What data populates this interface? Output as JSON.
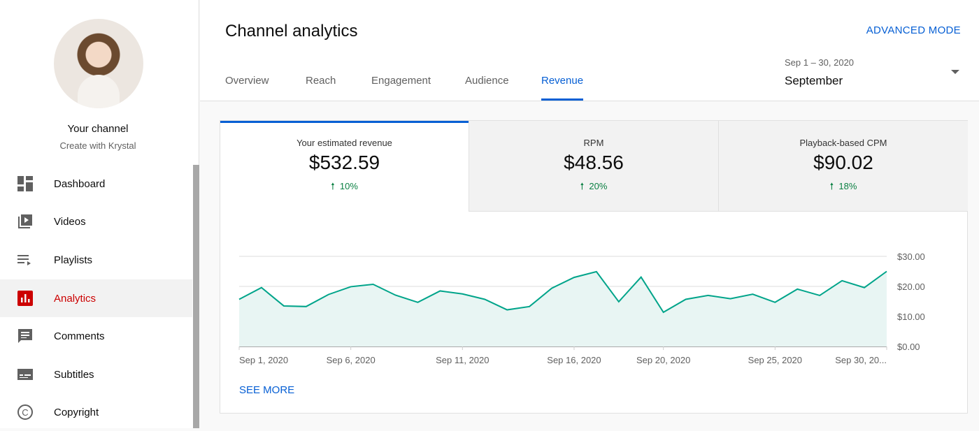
{
  "sidebar": {
    "channel_name": "Your channel",
    "channel_sub": "Create with Krystal",
    "items": [
      {
        "label": "Dashboard",
        "icon": "dashboard-icon"
      },
      {
        "label": "Videos",
        "icon": "videos-icon"
      },
      {
        "label": "Playlists",
        "icon": "playlists-icon"
      },
      {
        "label": "Analytics",
        "icon": "analytics-icon",
        "active": true
      },
      {
        "label": "Comments",
        "icon": "comments-icon"
      },
      {
        "label": "Subtitles",
        "icon": "subtitles-icon"
      },
      {
        "label": "Copyright",
        "icon": "copyright-icon"
      }
    ]
  },
  "header": {
    "title": "Channel analytics",
    "advanced_mode": "ADVANCED MODE",
    "tabs": [
      "Overview",
      "Reach",
      "Engagement",
      "Audience",
      "Revenue"
    ],
    "active_tab": "Revenue",
    "date_range": "Sep 1 – 30, 2020",
    "date_selected": "September"
  },
  "metrics": [
    {
      "label": "Your estimated revenue",
      "value": "$532.59",
      "delta": "10%",
      "trend": "up"
    },
    {
      "label": "RPM",
      "value": "$48.56",
      "delta": "20%",
      "trend": "up"
    },
    {
      "label": "Playback-based CPM",
      "value": "$90.02",
      "delta": "18%",
      "trend": "up"
    }
  ],
  "see_more": "SEE MORE",
  "colors": {
    "accent": "#065fd4",
    "line": "#00a48a",
    "fill": "#e8f5f3",
    "active_nav": "#cc0000",
    "positive": "#0b8043"
  },
  "chart_data": {
    "type": "area",
    "x": [
      "Sep 1",
      "Sep 2",
      "Sep 3",
      "Sep 4",
      "Sep 5",
      "Sep 6",
      "Sep 7",
      "Sep 8",
      "Sep 9",
      "Sep 10",
      "Sep 11",
      "Sep 12",
      "Sep 13",
      "Sep 14",
      "Sep 15",
      "Sep 16",
      "Sep 17",
      "Sep 18",
      "Sep 19",
      "Sep 20",
      "Sep 21",
      "Sep 22",
      "Sep 23",
      "Sep 24",
      "Sep 25",
      "Sep 26",
      "Sep 27",
      "Sep 28",
      "Sep 29",
      "Sep 30"
    ],
    "values": [
      15.7,
      19.6,
      13.5,
      13.3,
      17.3,
      19.9,
      20.7,
      17.1,
      14.7,
      18.5,
      17.5,
      15.7,
      12.2,
      13.3,
      19.4,
      23.0,
      24.9,
      14.9,
      23.1,
      11.4,
      15.7,
      17.0,
      15.9,
      17.4,
      14.7,
      19.1,
      17.0,
      21.9,
      19.6,
      25.0
    ],
    "x_tick_labels": [
      {
        "index": 0,
        "label": "Sep 1, 2020"
      },
      {
        "index": 5,
        "label": "Sep 6, 2020"
      },
      {
        "index": 10,
        "label": "Sep 11, 2020"
      },
      {
        "index": 15,
        "label": "Sep 16, 2020"
      },
      {
        "index": 19,
        "label": "Sep 20, 2020"
      },
      {
        "index": 24,
        "label": "Sep 25, 2020"
      },
      {
        "index": 29,
        "label": "Sep 30, 20..."
      }
    ],
    "y_ticks": [
      "$0.00",
      "$10.00",
      "$20.00",
      "$30.00"
    ],
    "ylim": [
      0,
      30
    ],
    "grid": true
  }
}
